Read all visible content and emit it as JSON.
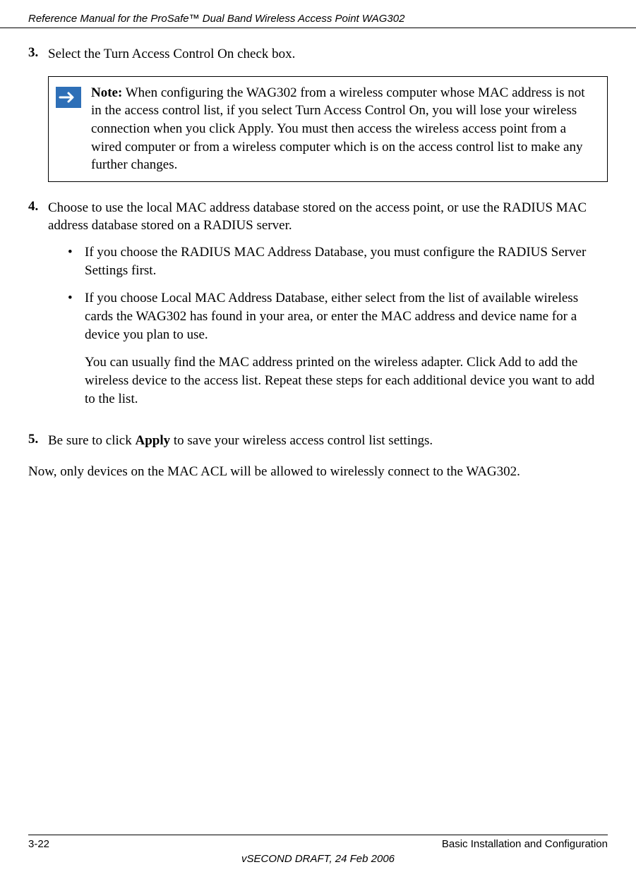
{
  "header": {
    "title": "Reference Manual for the ProSafe™ Dual Band Wireless Access Point WAG302"
  },
  "steps": {
    "s3": {
      "num": "3.",
      "text": "Select the Turn Access Control On check box."
    },
    "note": {
      "label": "Note:",
      "text": " When configuring the WAG302 from a wireless computer whose MAC address is not in the access control list, if you select Turn Access Control On, you will lose your wireless connection when you click Apply. You must then access the wireless access point from a wired computer or from a wireless computer which is on the access control list to make any further changes."
    },
    "s4": {
      "num": "4.",
      "text": "Choose to use the local MAC address database stored on the access point, or use the RADIUS MAC address database stored on a RADIUS server.",
      "bullets": [
        "If you choose the RADIUS MAC Address Database, you must configure the RADIUS Server Settings first.",
        "If you choose Local MAC Address Database, either select from the list of available wireless cards the WAG302 has found in your area, or enter the MAC address and device name for a device you plan to use."
      ],
      "sub": "You can usually find the MAC address printed on the wireless adapter. Click Add to add the wireless device to the access list. Repeat these steps for each additional device you want to add to the list."
    },
    "s5": {
      "num": "5.",
      "text_pre": "Be sure to click ",
      "bold": "Apply",
      "text_post": " to save your wireless access control list settings."
    },
    "final": "Now, only devices on the MAC ACL will be allowed to wirelessly connect to the WAG302."
  },
  "footer": {
    "page": "3-22",
    "section": "Basic Installation and Configuration",
    "version": "vSECOND DRAFT, 24 Feb 2006"
  }
}
